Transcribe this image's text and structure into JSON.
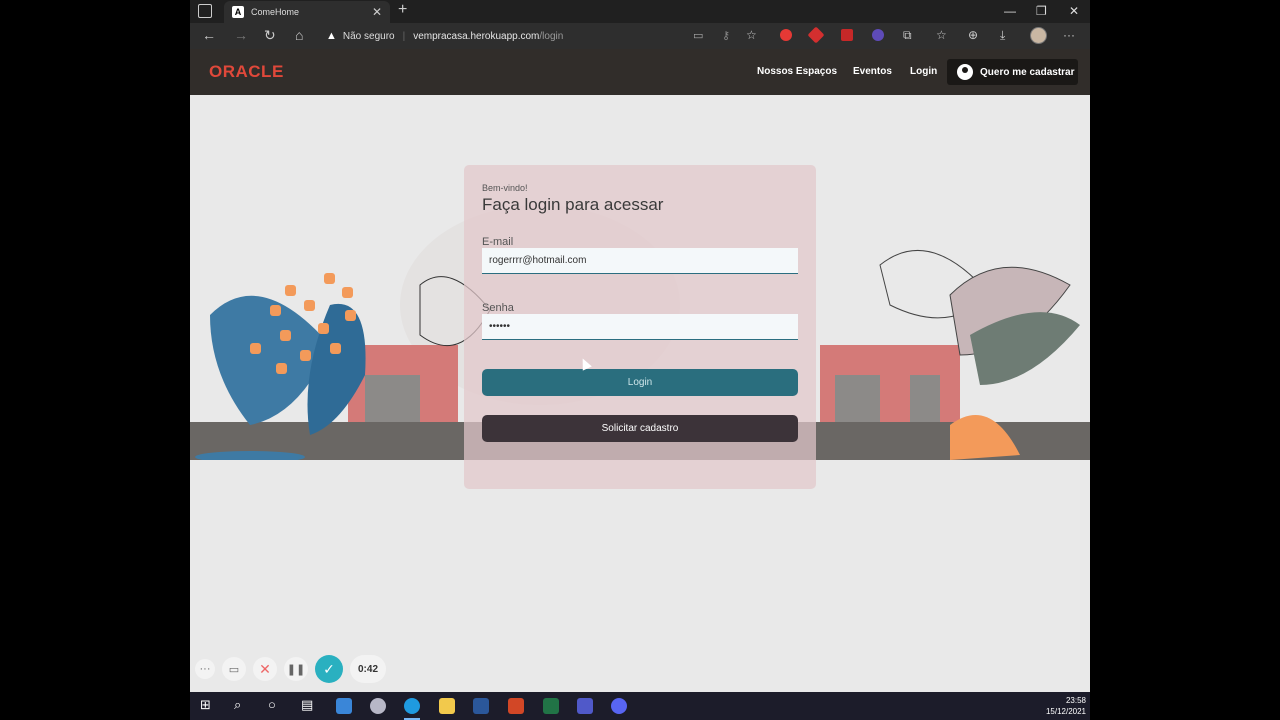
{
  "browser": {
    "tab_title": "ComeHome",
    "tab_favicon": "A",
    "new_tab_glyph": "+",
    "close_tab_glyph": "✕",
    "security_label": "Não seguro",
    "url_host": "vempracasa.herokuapp.com",
    "url_path": "/login",
    "window_controls": {
      "minimize": "—",
      "restore": "❐",
      "close": "✕"
    }
  },
  "site": {
    "logo": "ORACLE",
    "logo_color": "#e0483a",
    "nav": {
      "spaces": "Nossos Espaços",
      "events": "Eventos",
      "login": "Login",
      "signup": "Quero me cadastrar"
    }
  },
  "login": {
    "greeting": "Bem-vindo!",
    "title": "Faça login para acessar",
    "email_label": "E-mail",
    "email_value": "rogerrrr@hotmail.com",
    "password_label": "Senha",
    "password_value": "••••••",
    "login_button": "Login",
    "register_button": "Solicitar cadastro",
    "accent_color": "#2a6e7e"
  },
  "recorder": {
    "more_glyph": "···",
    "camera_glyph": "▭",
    "cancel_glyph": "✕",
    "pause_glyph": "❚❚",
    "done_glyph": "✓",
    "timer": "0:42"
  },
  "taskbar": {
    "time": "23:58",
    "date": "15/12/2021"
  }
}
